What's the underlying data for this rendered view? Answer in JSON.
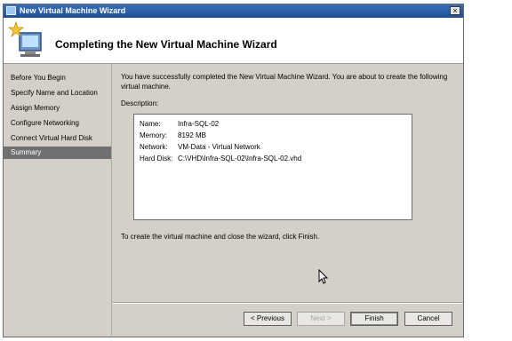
{
  "window": {
    "title": "New Virtual Machine Wizard",
    "close_glyph": "×"
  },
  "header": {
    "title": "Completing the New Virtual Machine Wizard",
    "icon": "wizard-computer-icon"
  },
  "nav": {
    "items": [
      {
        "label": "Before You Begin",
        "selected": false
      },
      {
        "label": "Specify Name and Location",
        "selected": false
      },
      {
        "label": "Assign Memory",
        "selected": false
      },
      {
        "label": "Configure Networking",
        "selected": false
      },
      {
        "label": "Connect Virtual Hard Disk",
        "selected": false
      },
      {
        "label": "Summary",
        "selected": true
      }
    ]
  },
  "content": {
    "intro": "You have successfully completed the New Virtual Machine Wizard. You are about to create the following virtual machine.",
    "description_label": "Description:",
    "description": [
      {
        "key": "Name:",
        "value": "Infra-SQL-02"
      },
      {
        "key": "Memory:",
        "value": "8192 MB"
      },
      {
        "key": "Network:",
        "value": "VM-Data - Virtual Network"
      },
      {
        "key": "Hard Disk:",
        "value": "C:\\VHD\\Infra-SQL-02\\Infra-SQL-02.vhd"
      }
    ],
    "finish_text": "To create the virtual machine and close the wizard, click Finish."
  },
  "buttons": {
    "previous": "< Previous",
    "next": "Next >",
    "finish": "Finish",
    "cancel": "Cancel"
  }
}
